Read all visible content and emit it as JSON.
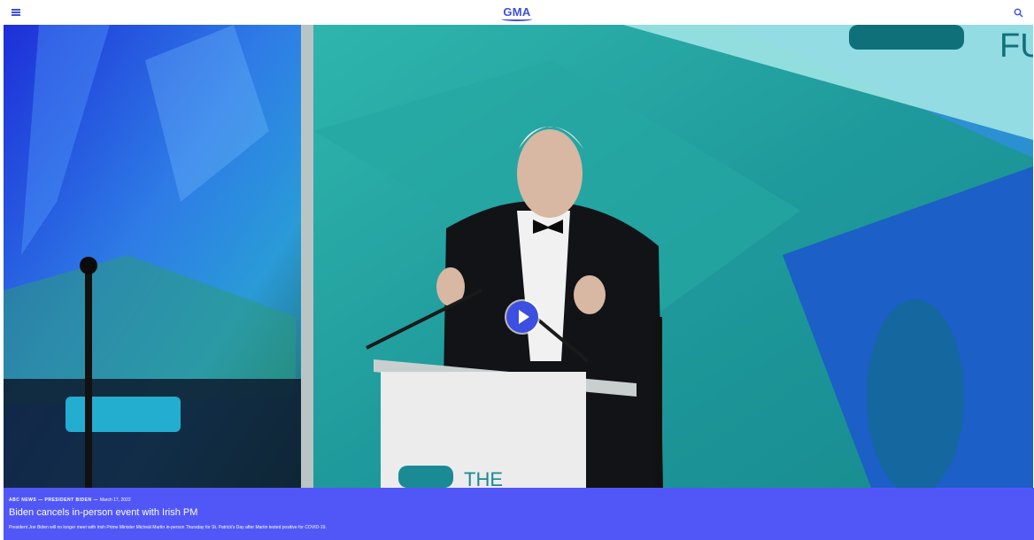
{
  "header": {
    "logo_text": "GMA",
    "menu_icon": "hamburger-menu-icon",
    "search_icon": "search-icon",
    "accent_color": "#3d4fe0"
  },
  "video": {
    "play_icon": "play-icon",
    "screen_text_fragment": "FU",
    "podium_text": "THE"
  },
  "caption": {
    "background_color": "#5157f7",
    "source": "ABC NEWS",
    "separator_1": "—",
    "category": "PRESIDENT BIDEN",
    "separator_2": "—",
    "date": "March 17, 2022",
    "headline": "Biden cancels in-person event with Irish PM",
    "summary": "President Joe Biden will no longer meet with Irish Prime Minister Micheál Martin in-person Thursday for St. Patrick's Day after Martin tested positive for COVID-19."
  }
}
